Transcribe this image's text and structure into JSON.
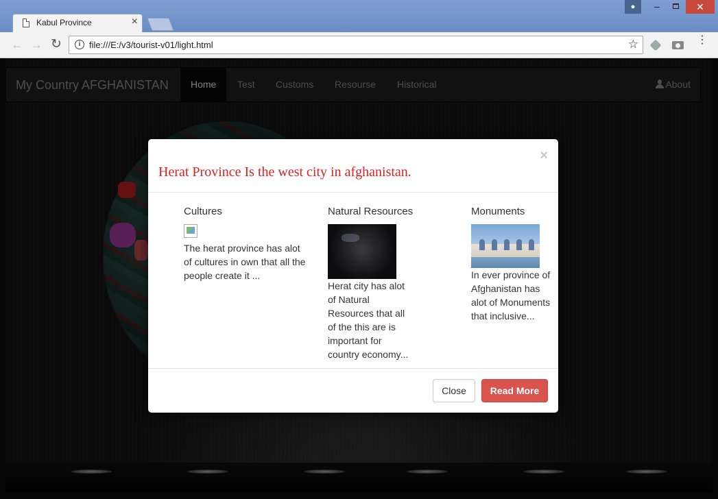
{
  "browser": {
    "tab_title": "Kabul Province",
    "tab_close": "×",
    "url": "file:///E:/v3/tourist-v01/light.html",
    "buttons": {
      "back": "←",
      "forward": "→",
      "reload": "↻",
      "star": "☆",
      "menu": "⋮"
    },
    "window": {
      "minimize": "–",
      "close": "✕"
    }
  },
  "navbar": {
    "brand": "My Country AFGHANISTAN",
    "items": [
      {
        "label": "Home",
        "active": true
      },
      {
        "label": "Test"
      },
      {
        "label": "Customs"
      },
      {
        "label": "Resourse"
      },
      {
        "label": "Historical"
      }
    ],
    "about": "About"
  },
  "modal": {
    "close_x": "×",
    "title": "Herat Province Is the west city in afghanistan.",
    "columns": [
      {
        "title": "Cultures",
        "text": "The herat province has alot of cultures in own that all the people create it ..."
      },
      {
        "title": "Natural Resources",
        "text": "Herat city has alot of Natural Resources that all of the this are is important for country economy..."
      },
      {
        "title": "Monuments",
        "text": "In ever province of Afghanistan has alot of Monuments that inclusive..."
      }
    ],
    "buttons": {
      "close": "Close",
      "read_more": "Read More"
    }
  },
  "colors": {
    "title_red": "#e02020",
    "read_more_bg": "#d9534f",
    "navbar_bg": "#222222",
    "browser_frame": "#6d8fc7"
  }
}
